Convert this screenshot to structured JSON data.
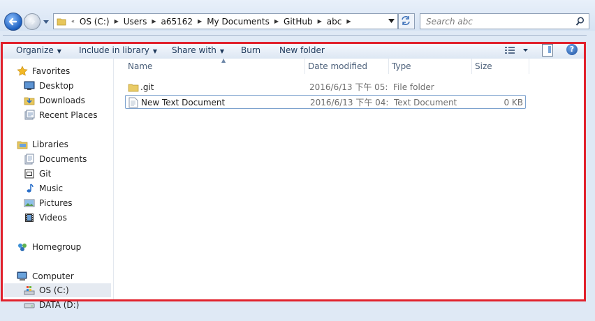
{
  "address": {
    "crumbs": [
      "OS (C:)",
      "Users",
      "a65162",
      "My Documents",
      "GitHub",
      "abc"
    ],
    "overflow": "«"
  },
  "search": {
    "placeholder": "Search abc"
  },
  "toolbar": {
    "organize": "Organize",
    "include_in_library": "Include in library",
    "share_with": "Share with",
    "burn": "Burn",
    "new_folder": "New folder"
  },
  "nav": {
    "favorites": "Favorites",
    "desktop": "Desktop",
    "downloads": "Downloads",
    "recent_places": "Recent Places",
    "libraries": "Libraries",
    "documents": "Documents",
    "git": "Git",
    "music": "Music",
    "pictures": "Pictures",
    "videos": "Videos",
    "homegroup": "Homegroup",
    "computer": "Computer",
    "os_c": "OS (C:)",
    "data_d": "DATA (D:)"
  },
  "columns": {
    "name": "Name",
    "date_modified": "Date modified",
    "type": "Type",
    "size": "Size"
  },
  "files": [
    {
      "name": ".git",
      "date": "2016/6/13 下午 05:...",
      "type": "File folder",
      "size": ""
    },
    {
      "name": "New Text Document",
      "date": "2016/6/13 下午 04:...",
      "type": "Text Document",
      "size": "0 KB"
    }
  ],
  "help_label": "?",
  "colors": {
    "highlight_frame": "#e1212c",
    "toolbar_text": "#1e395b"
  }
}
